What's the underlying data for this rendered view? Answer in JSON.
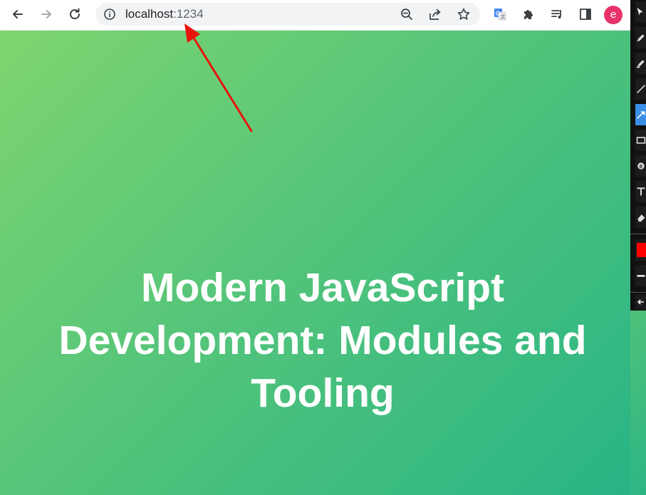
{
  "browser": {
    "url_host": "localhost",
    "url_port": ":1234",
    "avatar_letter": "e",
    "icons": {
      "back": "arrow-left-icon",
      "forward": "arrow-right-icon",
      "reload": "reload-icon",
      "info": "info-icon",
      "zoom": "zoom-out-icon",
      "share": "share-icon",
      "bookmark": "star-icon",
      "translate": "google-translate-icon",
      "extensions": "puzzle-icon",
      "reading_list": "reading-list-icon",
      "side_panel": "side-panel-icon"
    },
    "colors": {
      "avatar": "#e8336a",
      "toolbar": "#ffffff",
      "omnibox": "#f1f3f4"
    }
  },
  "page": {
    "title": "Modern JavaScript Development: Modules and Tooling",
    "gradient": [
      "#7ed56f",
      "#28b485"
    ]
  },
  "annotation": {
    "color": "#e8140c",
    "type": "arrow"
  },
  "drawing_tools": {
    "items": [
      "select-pointer",
      "pen",
      "marker",
      "line",
      "arrow",
      "rectangle",
      "stamp",
      "text",
      "eraser"
    ],
    "active": "arrow",
    "color_swatch": "#ff0000"
  }
}
